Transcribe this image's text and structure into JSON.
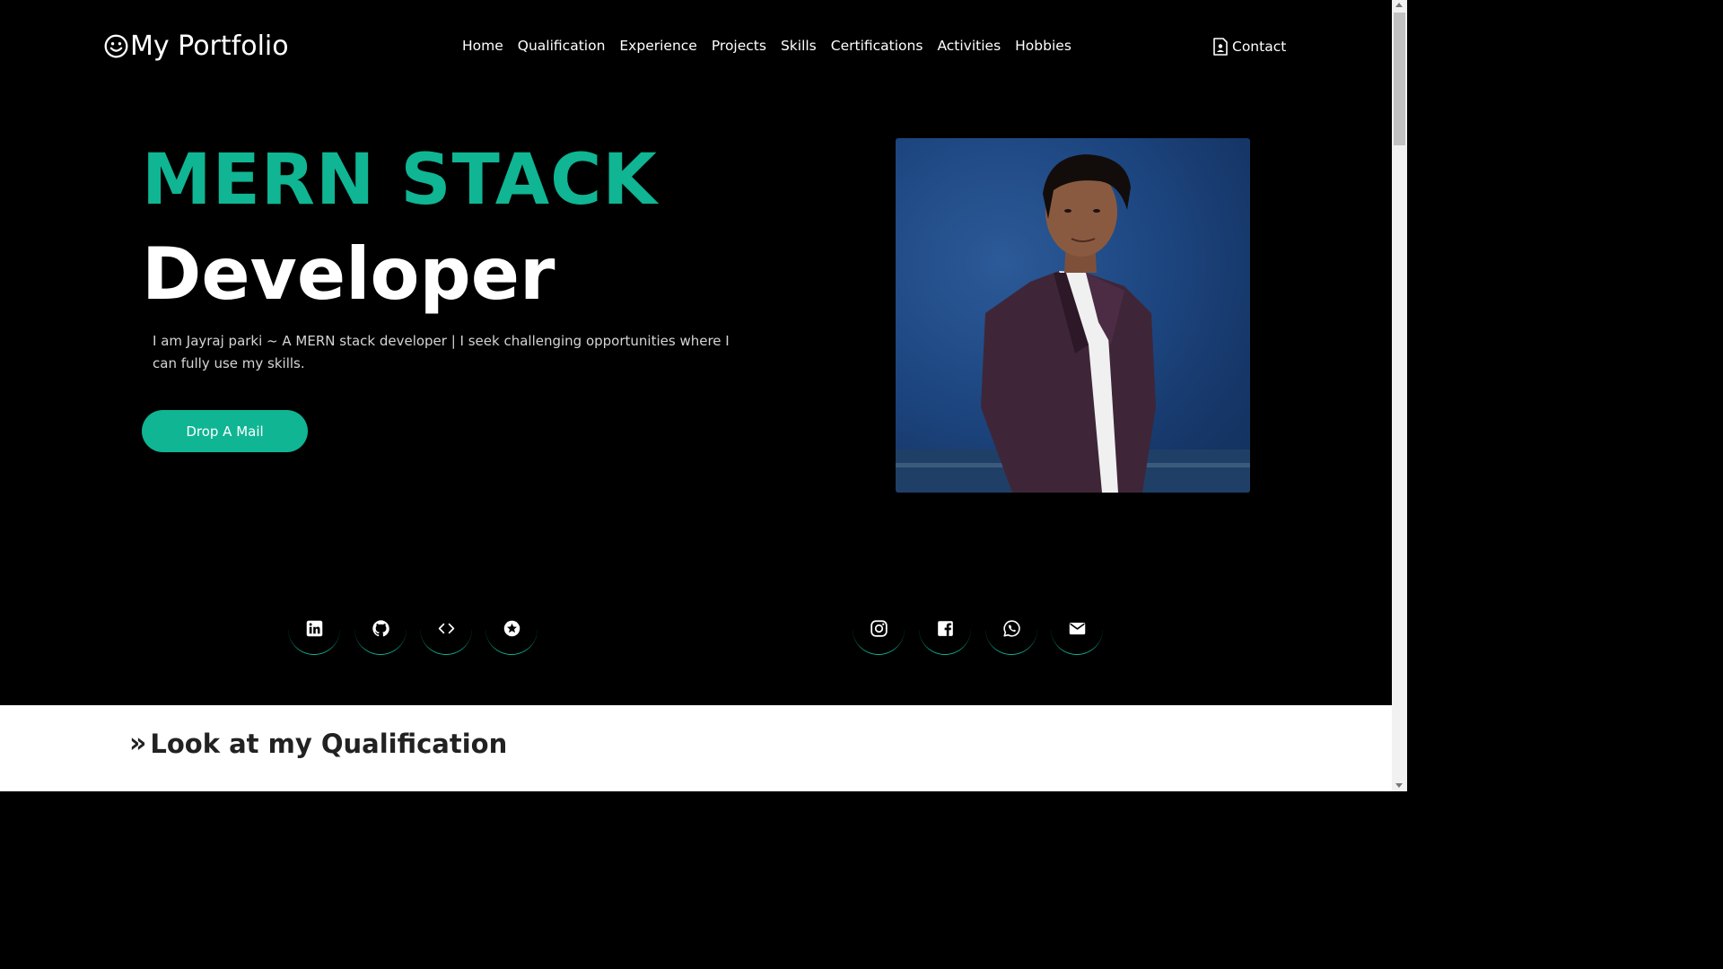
{
  "brand": {
    "text": "My Portfolio",
    "icon": "smiley-icon"
  },
  "nav": {
    "items": [
      "Home",
      "Qualification",
      "Experience",
      "Projects",
      "Skills",
      "Certifications",
      "Activities",
      "Hobbies"
    ],
    "contact_label": "Contact"
  },
  "hero": {
    "title_line1": "MERN STACK",
    "title_line2": "Developer",
    "description": "I am Jayraj parki ~ A MERN stack developer | I seek challenging opportunities where I can fully use my skills.",
    "cta_label": "Drop A Mail"
  },
  "socials": {
    "left": [
      "linkedin-icon",
      "github-icon",
      "code-icon",
      "star-badge-icon"
    ],
    "right": [
      "instagram-icon",
      "facebook-icon",
      "whatsapp-icon",
      "mail-icon"
    ]
  },
  "section": {
    "title": "Look at my Qualification"
  },
  "colors": {
    "accent": "#10b593",
    "background": "#000000",
    "text": "#ffffff"
  }
}
